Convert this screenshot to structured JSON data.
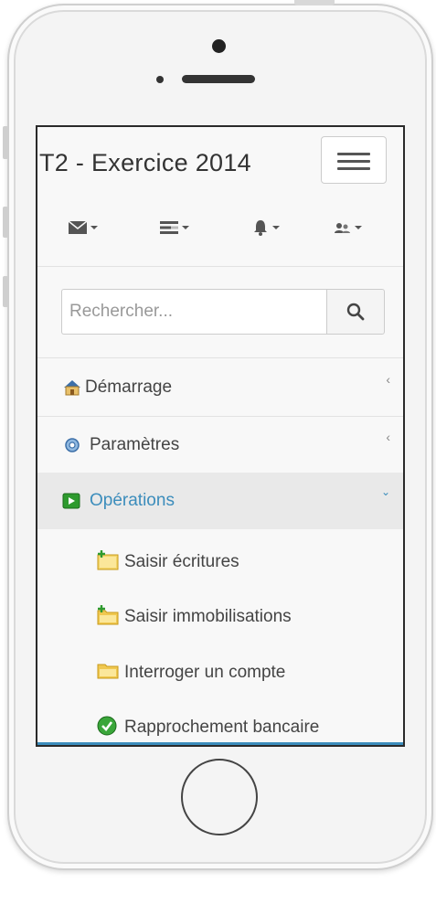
{
  "app": {
    "title": "T2 - Exercice 2014"
  },
  "search": {
    "placeholder": "Rechercher..."
  },
  "iconbar": [
    {
      "icon": "envelope-icon"
    },
    {
      "icon": "tasks-icon"
    },
    {
      "icon": "bell-icon"
    },
    {
      "icon": "users-icon"
    }
  ],
  "menu": {
    "items": [
      {
        "label": "Démarrage",
        "icon": "home-icon",
        "expanded": false
      },
      {
        "label": "Paramètres",
        "icon": "settings-icon",
        "expanded": false
      },
      {
        "label": "Opérations",
        "icon": "operations-icon",
        "expanded": true
      }
    ],
    "subitems": [
      {
        "label": "Saisir écritures",
        "icon": "new-folder-icon"
      },
      {
        "label": "Saisir immobilisations",
        "icon": "add-folder-icon"
      },
      {
        "label": "Interroger un compte",
        "icon": "folder-icon"
      },
      {
        "label": "Rapprochement bancaire",
        "icon": "check-circle-icon"
      }
    ]
  },
  "colors": {
    "accent": "#3c8dbc",
    "text": "#444444"
  }
}
